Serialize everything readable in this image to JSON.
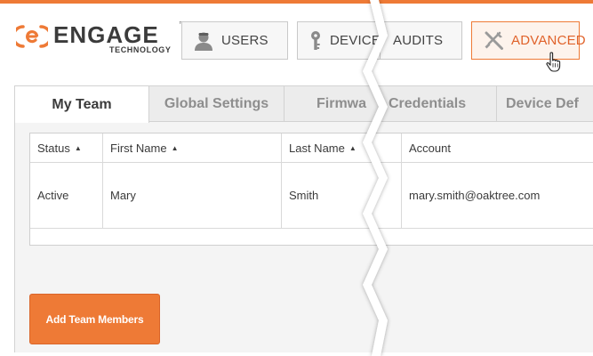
{
  "logo": {
    "word": "ENGAGE",
    "tm": "™",
    "sub": "TECHNOLOGY"
  },
  "nav": {
    "users": "USERS",
    "devices": "DEVICE",
    "audits": "AUDITS",
    "advanced": "ADVANCED"
  },
  "tabs": {
    "my_team": "My Team",
    "global_settings": "Global Settings",
    "firmware": "Firmwa",
    "credentials": "Credentials",
    "device_def": "Device Def"
  },
  "table": {
    "columns": [
      "Status",
      "First Name",
      "Last Name",
      "Account"
    ],
    "sort_glyph": "▲",
    "rows": [
      [
        "Active",
        "Mary",
        "Smith",
        "mary.smith@oaktree.com"
      ]
    ]
  },
  "actions": {
    "add_team_members": "Add Team Members"
  },
  "colors": {
    "accent": "#ee7a36",
    "text": "#3b3b3b",
    "muted": "#8e8e8e"
  }
}
